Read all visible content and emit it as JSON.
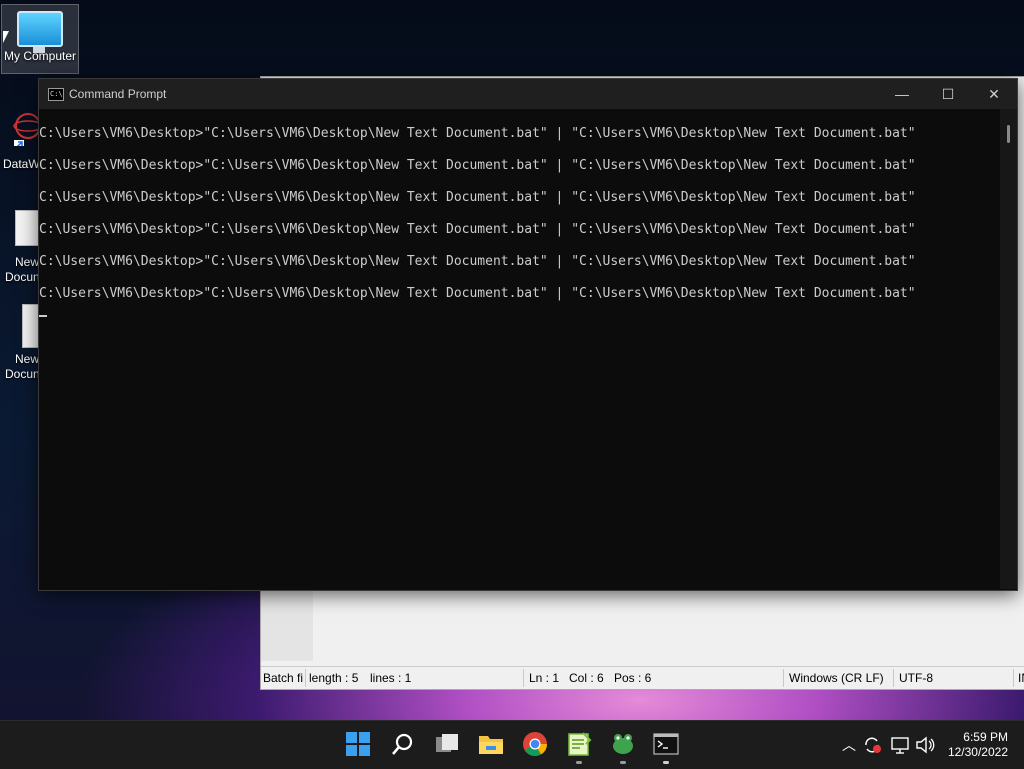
{
  "desktop": {
    "icons": {
      "my_computer": "My Computer",
      "dataw": "DataW",
      "new_doc_1a": "New",
      "new_doc_1b": "Docun",
      "new_doc_2a": "New",
      "new_doc_2b": "Docun"
    }
  },
  "cmd": {
    "title": "Command Prompt",
    "icon_text": "C:\\",
    "lines": [
      "C:\\Users\\VM6\\Desktop>\"C:\\Users\\VM6\\Desktop\\New Text Document.bat\" | \"C:\\Users\\VM6\\Desktop\\New Text Document.bat\"",
      "C:\\Users\\VM6\\Desktop>\"C:\\Users\\VM6\\Desktop\\New Text Document.bat\" | \"C:\\Users\\VM6\\Desktop\\New Text Document.bat\"",
      "C:\\Users\\VM6\\Desktop>\"C:\\Users\\VM6\\Desktop\\New Text Document.bat\" | \"C:\\Users\\VM6\\Desktop\\New Text Document.bat\"",
      "C:\\Users\\VM6\\Desktop>\"C:\\Users\\VM6\\Desktop\\New Text Document.bat\" | \"C:\\Users\\VM6\\Desktop\\New Text Document.bat\"",
      "C:\\Users\\VM6\\Desktop>\"C:\\Users\\VM6\\Desktop\\New Text Document.bat\" | \"C:\\Users\\VM6\\Desktop\\New Text Document.bat\"",
      "C:\\Users\\VM6\\Desktop>\"C:\\Users\\VM6\\Desktop\\New Text Document.bat\" | \"C:\\Users\\VM6\\Desktop\\New Text Document.bat\""
    ],
    "buttons": {
      "minimize": "—",
      "maximize": "☐",
      "close": "✕"
    }
  },
  "notepad_status": {
    "file_type": "Batch fi",
    "length": "length : 5",
    "lines": "lines : 1",
    "ln": "Ln : 1",
    "col": "Col : 6",
    "pos": "Pos : 6",
    "eol": "Windows (CR LF)",
    "encoding": "UTF-8",
    "mode": "IN"
  },
  "taskbar": {
    "icons": [
      "windows-start-icon",
      "search-icon",
      "task-view-icon",
      "file-explorer-icon",
      "chrome-icon",
      "notepad-plus-plus-icon",
      "frog-app-icon",
      "command-prompt-icon"
    ],
    "clock": {
      "time": "6:59 PM",
      "date": "12/30/2022"
    }
  },
  "colors": {
    "cmd_bg": "#0c0c0c",
    "cmd_text": "#cccccc",
    "taskbar_bg": "#1c1c1c"
  }
}
